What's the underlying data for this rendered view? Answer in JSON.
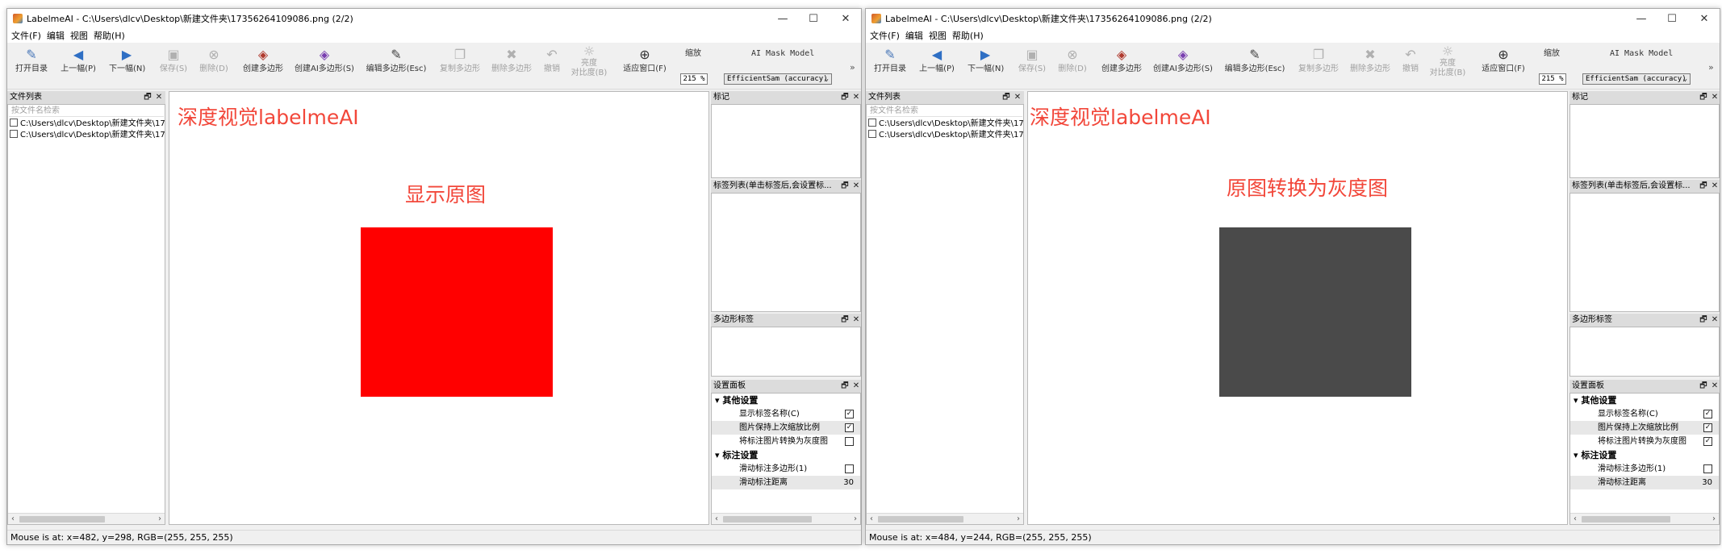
{
  "windows": [
    {
      "title": "LabelmeAI - C:\\Users\\dlcv\\Desktop\\新建文件夹\\17356264109086.png (2/2)",
      "menu": [
        "文件(F)",
        "编辑",
        "视图",
        "帮助(H)"
      ],
      "toolbar": {
        "open_dir": "打开目录",
        "prev": "上一幅(P)",
        "next": "下一幅(N)",
        "save": "保存(S)",
        "delete": "删除(D)",
        "create_poly": "创建多边形",
        "create_ai_poly": "创建AI多边形(S)",
        "edit_poly": "编辑多边形(Esc)",
        "copy_poly": "复制多边形",
        "delete_poly": "删除多边形",
        "undo": "撤销",
        "brightness_1": "亮度",
        "brightness_2": "对比度(B)",
        "fit_window": "适应窗口(F)",
        "zoom_label": "缩放",
        "zoom_value": "215 %",
        "ai_model_label": "AI Mask Model",
        "ai_model_value": "EfficientSam (accuracy)",
        "more": "»"
      },
      "file_list": {
        "title": "文件列表",
        "search_placeholder": "按文件名检索",
        "items": [
          "C:\\Users\\dlcv\\Desktop\\新建文件夹\\17",
          "C:\\Users\\dlcv\\Desktop\\新建文件夹\\17"
        ]
      },
      "canvas": {
        "watermark": "深度视觉labelmeAI",
        "caption": "显示原图",
        "image_color": "#ff0000"
      },
      "panels": {
        "flags": "标记",
        "label_list": "标签列表(单击标签后,会设置标...",
        "poly_labels": "多边形标签",
        "settings": "设置面板"
      },
      "settings": {
        "group1": "其他设置",
        "rows1": [
          {
            "label": "显示标签名称(C)",
            "checked": true
          },
          {
            "label": "图片保持上次缩放比例",
            "checked": true
          },
          {
            "label": "将标注图片转换为灰度图",
            "checked": false
          }
        ],
        "group2": "标注设置",
        "rows2": [
          {
            "label": "滑动标注多边形(1)",
            "checked": false
          }
        ],
        "distance_label": "滑动标注距离",
        "distance_value": "30"
      },
      "status": "Mouse is at: x=482, y=298, RGB=(255, 255, 255)"
    },
    {
      "title": "LabelmeAI - C:\\Users\\dlcv\\Desktop\\新建文件夹\\17356264109086.png (2/2)",
      "menu": [
        "文件(F)",
        "编辑",
        "视图",
        "帮助(H)"
      ],
      "toolbar": {
        "open_dir": "打开目录",
        "prev": "上一幅(P)",
        "next": "下一幅(N)",
        "save": "保存(S)",
        "delete": "删除(D)",
        "create_poly": "创建多边形",
        "create_ai_poly": "创建AI多边形(S)",
        "edit_poly": "编辑多边形(Esc)",
        "copy_poly": "复制多边形",
        "delete_poly": "删除多边形",
        "undo": "撤销",
        "brightness_1": "亮度",
        "brightness_2": "对比度(B)",
        "fit_window": "适应窗口(F)",
        "zoom_label": "缩放",
        "zoom_value": "215 %",
        "ai_model_label": "AI Mask Model",
        "ai_model_value": "EfficientSam (accuracy)",
        "more": "»"
      },
      "file_list": {
        "title": "文件列表",
        "search_placeholder": "按文件名检索",
        "items": [
          "C:\\Users\\dlcv\\Desktop\\新建文件夹\\17",
          "C:\\Users\\dlcv\\Desktop\\新建文件夹\\17"
        ]
      },
      "canvas": {
        "watermark": "深度视觉labelmeAI",
        "caption": "原图转换为灰度图",
        "image_color": "#4a4a4a"
      },
      "panels": {
        "flags": "标记",
        "label_list": "标签列表(单击标签后,会设置标...",
        "poly_labels": "多边形标签",
        "settings": "设置面板"
      },
      "settings": {
        "group1": "其他设置",
        "rows1": [
          {
            "label": "显示标签名称(C)",
            "checked": true
          },
          {
            "label": "图片保持上次缩放比例",
            "checked": true
          },
          {
            "label": "将标注图片转换为灰度图",
            "checked": true
          }
        ],
        "group2": "标注设置",
        "rows2": [
          {
            "label": "滑动标注多边形(1)",
            "checked": false
          }
        ],
        "distance_label": "滑动标注距离",
        "distance_value": "30"
      },
      "status": "Mouse is at: x=484, y=244, RGB=(255, 255, 255)"
    }
  ]
}
